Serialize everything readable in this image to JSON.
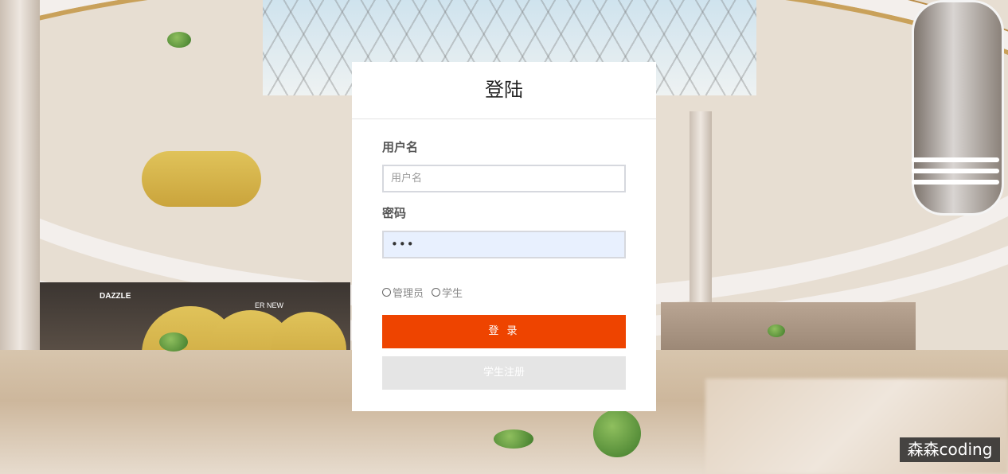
{
  "login": {
    "title": "登陆",
    "username_label": "用户名",
    "username_placeholder": "用户名",
    "username_value": "",
    "password_label": "密码",
    "password_value": "•••",
    "roles": [
      {
        "label": "管理员",
        "selected": false
      },
      {
        "label": "学生",
        "selected": false
      }
    ],
    "login_button": "登 录",
    "register_button": "学生注册"
  },
  "background": {
    "store_sign": "DAZZLE",
    "store_sign_2": "ER NEW"
  },
  "watermark": "森森coding",
  "colors": {
    "primary": "#ee4400",
    "secondary_button": "#e5e5e5",
    "autofill": "#e8f0fe"
  }
}
